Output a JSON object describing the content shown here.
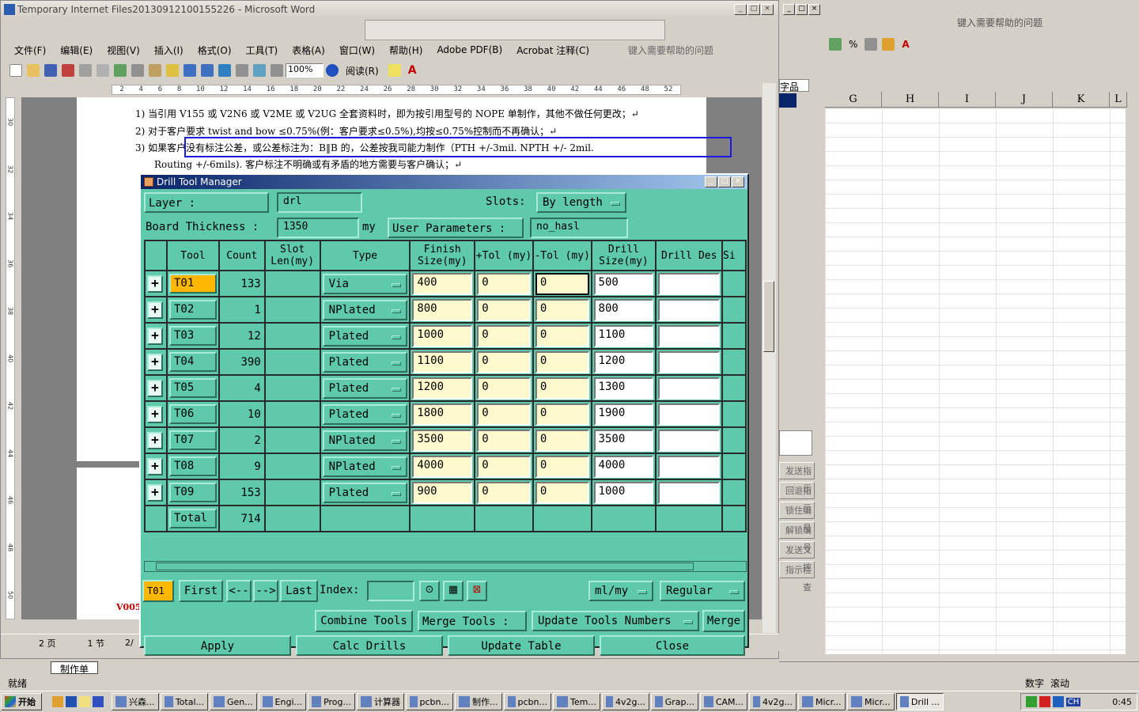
{
  "word": {
    "title": "Temporary Internet Files20130912100155226 - Microsoft Word",
    "menu": [
      "文件(F)",
      "编辑(E)",
      "视图(V)",
      "插入(I)",
      "格式(O)",
      "工具(T)",
      "表格(A)",
      "窗口(W)",
      "帮助(H)",
      "Adobe PDF(B)",
      "Acrobat 注释(C)"
    ],
    "help_placeholder": "键入需要帮助的问题",
    "zoom": "100%",
    "read_label": "阅读(R)",
    "ruler_marks": [
      "2",
      "4",
      "6",
      "8",
      "10",
      "12",
      "14",
      "16",
      "18",
      "20",
      "22",
      "24",
      "26",
      "28",
      "30",
      "32",
      "34",
      "36",
      "38",
      "40",
      "42",
      "44",
      "46",
      "48",
      "52"
    ],
    "vruler_marks": [
      "30",
      "32",
      "34",
      "36",
      "38",
      "40",
      "42",
      "44",
      "46",
      "48",
      "50"
    ],
    "lines": [
      "1) 当引用 V155 或 V2N6 或 V2ME 或 V2UG 全套资料时，即为按引用型号的 NOPE 单制作，其他不做任何更改；↵",
      "2) 对于客户要求 twist and bow ≤0.75%(例：客户要求≤0.5%),均按≤0.75%控制而不再确认；↵",
      "3) 如果客户没有标注公差，或公差标注为：B‖B 的，公差按我司能力制作（PTH +/-3mil. NPTH +/- 2mil.",
      "Routing +/-6mils). 客户标注不明确或有矛盾的地方需要与客户确认；↵"
    ],
    "left_code": "V005",
    "status": {
      "page": "2 页",
      "section": "1 节",
      "pos": "2/"
    }
  },
  "excel": {
    "help_placeholder": "键入需要帮助的问题",
    "columns": [
      "G",
      "H",
      "I",
      "J",
      "K",
      "L"
    ],
    "sheet_tab": "制作单",
    "side_buttons": [
      "发送指示",
      "回退指示",
      "锁住编号",
      "解锁编号",
      "发送文控",
      "指示检查"
    ],
    "title_frag": "字品",
    "status_left": "就绪",
    "status_num": "数字",
    "status_scroll": "滚动"
  },
  "dialog": {
    "title": "Drill Tool Manager",
    "layer_label": "Layer        :",
    "layer_value": "drl",
    "slots_label": "Slots:",
    "slots_value": "By length",
    "board_label": "Board Thickness :",
    "board_value": "1350",
    "board_unit": "my",
    "user_params_label": "User Parameters  :",
    "user_params_value": "no_hasl",
    "headers": [
      "Tool",
      "Count",
      "Slot Len(my)",
      "Type",
      "Finish Size(my)",
      "+Tol (my)",
      "-Tol (my)",
      "Drill Size(my)",
      "Drill Des",
      "Si"
    ],
    "rows": [
      {
        "tool": "T01",
        "count": "133",
        "type": "Via",
        "finish": "400",
        "ptol": "0",
        "mtol": "0",
        "drill": "500"
      },
      {
        "tool": "T02",
        "count": "1",
        "type": "NPlated",
        "finish": "800",
        "ptol": "0",
        "mtol": "0",
        "drill": "800"
      },
      {
        "tool": "T03",
        "count": "12",
        "type": "Plated",
        "finish": "1000",
        "ptol": "0",
        "mtol": "0",
        "drill": "1100"
      },
      {
        "tool": "T04",
        "count": "390",
        "type": "Plated",
        "finish": "1100",
        "ptol": "0",
        "mtol": "0",
        "drill": "1200"
      },
      {
        "tool": "T05",
        "count": "4",
        "type": "Plated",
        "finish": "1200",
        "ptol": "0",
        "mtol": "0",
        "drill": "1300"
      },
      {
        "tool": "T06",
        "count": "10",
        "type": "Plated",
        "finish": "1800",
        "ptol": "0",
        "mtol": "0",
        "drill": "1900"
      },
      {
        "tool": "T07",
        "count": "2",
        "type": "NPlated",
        "finish": "3500",
        "ptol": "0",
        "mtol": "0",
        "drill": "3500"
      },
      {
        "tool": "T08",
        "count": "9",
        "type": "NPlated",
        "finish": "4000",
        "ptol": "0",
        "mtol": "0",
        "drill": "4000"
      },
      {
        "tool": "T09",
        "count": "153",
        "type": "Plated",
        "finish": "900",
        "ptol": "0",
        "mtol": "0",
        "drill": "1000"
      }
    ],
    "total_label": "Total",
    "total_value": "714",
    "nav": {
      "current": "T01",
      "first": "First",
      "prev": "<--",
      "next": "-->",
      "last": "Last",
      "index_label": "Index:",
      "units": "ml/my",
      "mode": "Regular"
    },
    "buttons": {
      "combine": "Combine Tools",
      "merge_label": "Merge Tools  :",
      "update_nums": "Update Tools Numbers",
      "merge": "Merge",
      "apply": "Apply",
      "calc": "Calc Drills",
      "update_table": "Update Table",
      "close": "Close"
    }
  },
  "taskbar": {
    "start": "开始",
    "tasks": [
      "兴森...",
      "Total...",
      "Gen...",
      "Engi...",
      "Prog...",
      "计算器",
      "pcbn...",
      "制作...",
      "pcbn...",
      "Tem...",
      "4v2g...",
      "Grap...",
      "CAM...",
      "4v2g...",
      "Micr...",
      "Micr...",
      "Drill ..."
    ],
    "clock": "0:45",
    "tray_lang": "CH"
  }
}
